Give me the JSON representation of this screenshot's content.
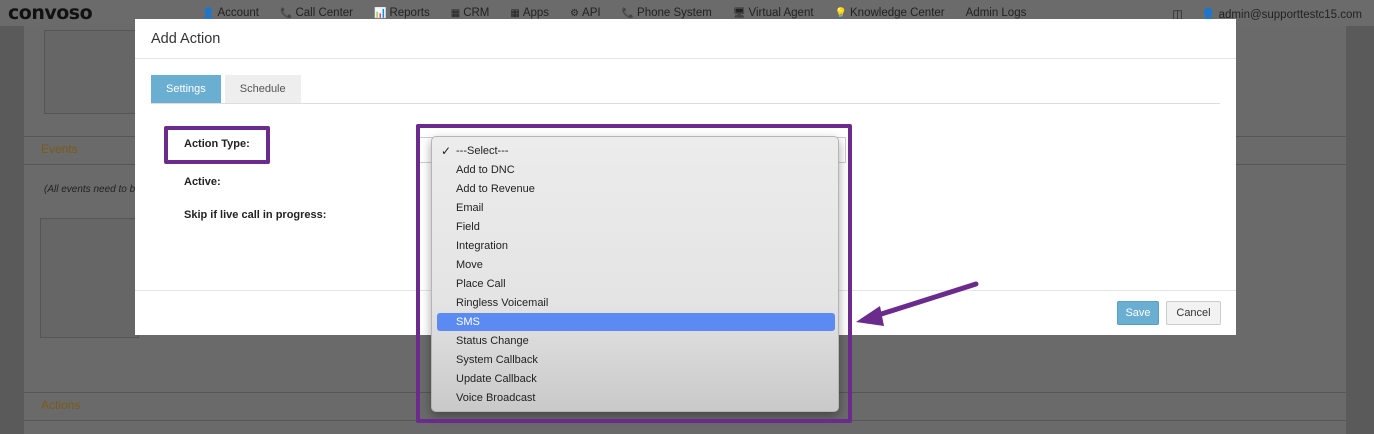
{
  "logo": "convoso",
  "nav": {
    "items": [
      {
        "icon": "👤",
        "label": "Account"
      },
      {
        "icon": "📞",
        "label": "Call Center"
      },
      {
        "icon": "📊",
        "label": "Reports"
      },
      {
        "icon": "▦",
        "label": "CRM"
      },
      {
        "icon": "▦",
        "label": "Apps"
      },
      {
        "icon": "⚙",
        "label": "API"
      },
      {
        "icon": "📞",
        "label": "Phone System"
      },
      {
        "icon": "🖥",
        "label": "Virtual Agent"
      },
      {
        "icon": "💡",
        "label": "Knowledge Center"
      },
      {
        "icon": "",
        "label": "Admin Logs"
      }
    ],
    "user": "admin@supporttestc15.com"
  },
  "background": {
    "events_title": "Events",
    "events_note": "(All events need to b",
    "actions_title": "Actions"
  },
  "modal": {
    "title": "Add Action",
    "tabs": [
      {
        "label": "Settings",
        "active": true
      },
      {
        "label": "Schedule",
        "active": false
      }
    ],
    "fields": {
      "action_type": "Action Type:",
      "active": "Active:",
      "skip_live": "Skip if live call in progress:"
    },
    "save_label": "Save",
    "cancel_label": "Cancel"
  },
  "dropdown": {
    "check": "✓",
    "selected_value": "SMS",
    "options": [
      "---Select---",
      "Add to DNC",
      "Add to Revenue",
      "Email",
      "Field",
      "Integration",
      "Move",
      "Place Call",
      "Ringless Voicemail",
      "SMS",
      "Status Change",
      "System Callback",
      "Update Callback",
      "Voice Broadcast"
    ]
  },
  "colors": {
    "accent": "#6aaed2",
    "highlight_select": "#5b8af2",
    "annotation": "#6a2b8c"
  }
}
